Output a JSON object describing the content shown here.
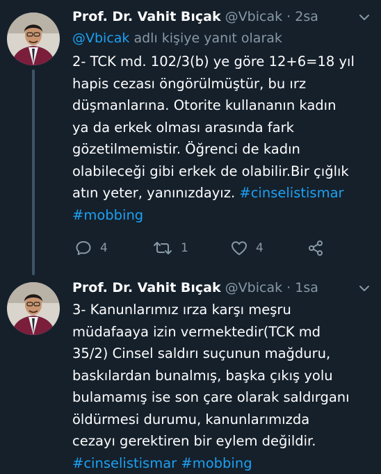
{
  "tweets": [
    {
      "author_name": "Prof. Dr. Vahit Bıçak",
      "author_handle": "@Vbicak",
      "dot": "·",
      "time": "2sa",
      "reply_to_handle": "@Vbicak",
      "reply_to_suffix": " adlı kişiye yanıt olarak",
      "lines": [
        "2- TCK md. 102/3(b) ye göre 12+6=18 yıl",
        "hapis cezası öngörülmüştür, bu ırz",
        "düşmanlarına. Otorite kullananın kadın",
        "ya da erkek olması arasında fark",
        "gözetilmemistir. Öğrenci de kadın",
        "olabileceği gibi erkek de olabilir.Bir çığlık"
      ],
      "line7_text": "atın yeter, yanınızdayız. ",
      "line7_hashtag": "#cinselistismar",
      "line8_hashtag": "#mobbing",
      "reply_count": "4",
      "retweet_count": "1",
      "like_count": "4"
    },
    {
      "author_name": "Prof. Dr. Vahit Bıçak",
      "author_handle": "@Vbicak",
      "dot": "·",
      "time": "1sa",
      "lines": [
        "3- Kanunlarımız ırza karşı meşru",
        "müdafaaya izin vermektedir(TCK md",
        "35/2) Cinsel saldırı suçunun mağduru,",
        "baskılardan bunalmış, başka çıkış yolu",
        "bulamamış ise son çare olarak saldırganı",
        "öldürmesi durumu, kanunlarımızda",
        "cezayı gerektiren bir eylem değildir."
      ],
      "hashtag_1": "#cinselistismar",
      "hashtag_2": "#mobbing"
    }
  ],
  "icons": {
    "caret": "chevron-down-icon",
    "reply": "reply-icon",
    "retweet": "retweet-icon",
    "like": "heart-icon",
    "share": "share-icon"
  },
  "colors": {
    "background": "#15202b",
    "secondary_text": "#8899a6",
    "link": "#1da1f2",
    "thread_line": "#3d5466",
    "avatar_jacket": "#7a1e3c"
  }
}
